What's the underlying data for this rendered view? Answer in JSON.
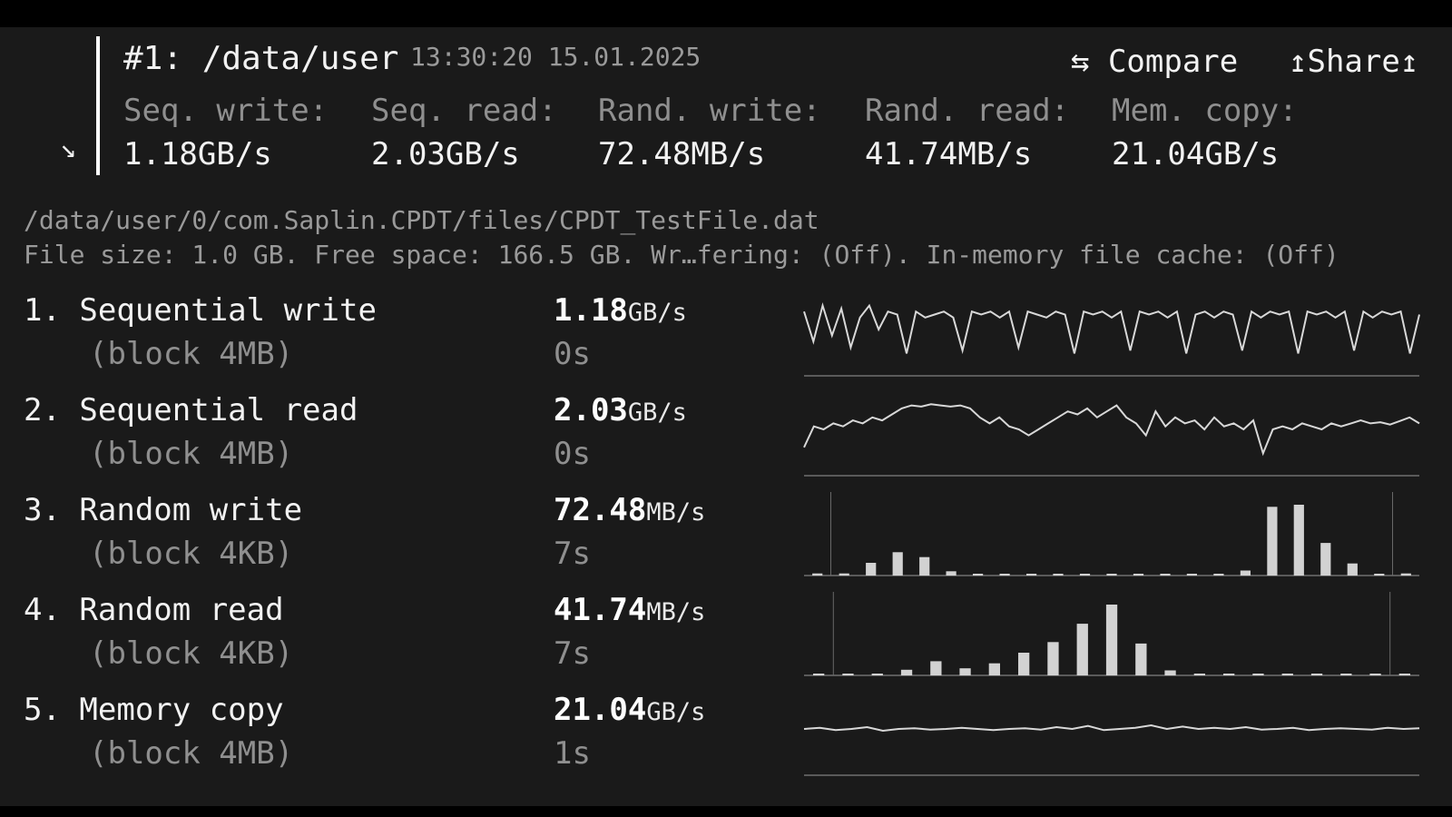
{
  "header": {
    "title": "#1: /data/user",
    "timestamp": "13:30:20 15.01.2025",
    "compare_label": "⇆ Compare",
    "share_label": "↥Share↥",
    "corner_arrow": "↘"
  },
  "summary": [
    {
      "label": "Seq. write:",
      "value": "1.18GB/s"
    },
    {
      "label": "Seq. read:",
      "value": "2.03GB/s"
    },
    {
      "label": "Rand. write:",
      "value": "72.48MB/s"
    },
    {
      "label": "Rand. read:",
      "value": "41.74MB/s"
    },
    {
      "label": "Mem. copy:",
      "value": "21.04GB/s"
    }
  ],
  "file_path": "/data/user/0/com.Saplin.CPDT/files/CPDT_TestFile.dat",
  "file_info": "File size: 1.0 GB. Free space: 166.5 GB. Wr…fering: (Off). In-memory file cache: (Off)",
  "tests": [
    {
      "name": "1. Sequential write",
      "block": "(block 4MB)",
      "value": "1.18",
      "unit": "GB/s",
      "time": "0s"
    },
    {
      "name": "2. Sequential read",
      "block": "(block 4MB)",
      "value": "2.03",
      "unit": "GB/s",
      "time": "0s"
    },
    {
      "name": "3. Random write",
      "block": "(block 4KB)",
      "value": "72.48",
      "unit": "MB/s",
      "time": "7s"
    },
    {
      "name": "4. Random read",
      "block": "(block 4KB)",
      "value": "41.74",
      "unit": "MB/s",
      "time": "7s"
    },
    {
      "name": "5. Memory copy",
      "block": "(block 4MB)",
      "value": "21.04",
      "unit": "GB/s",
      "time": "1s"
    }
  ],
  "chart_data": [
    {
      "type": "line",
      "series": [
        {
          "values": [
            0.8,
            0.3,
            0.9,
            0.4,
            0.85,
            0.2,
            0.7,
            0.9,
            0.5,
            0.8,
            0.75,
            0.1,
            0.8,
            0.7,
            0.75,
            0.8,
            0.7,
            0.15,
            0.8,
            0.75,
            0.8,
            0.7,
            0.8,
            0.2,
            0.8,
            0.75,
            0.7,
            0.8,
            0.75,
            0.1,
            0.8,
            0.75,
            0.8,
            0.7,
            0.8,
            0.15,
            0.8,
            0.75,
            0.8,
            0.7,
            0.8,
            0.1,
            0.75,
            0.8,
            0.7,
            0.8,
            0.75,
            0.15,
            0.8,
            0.7,
            0.8,
            0.75,
            0.8,
            0.1,
            0.8,
            0.75,
            0.8,
            0.7,
            0.8,
            0.15,
            0.8,
            0.7,
            0.8,
            0.75,
            0.8,
            0.1,
            0.75
          ]
        }
      ]
    },
    {
      "type": "line",
      "series": [
        {
          "values": [
            0.2,
            0.55,
            0.5,
            0.6,
            0.55,
            0.65,
            0.6,
            0.7,
            0.65,
            0.75,
            0.85,
            0.9,
            0.88,
            0.92,
            0.9,
            0.88,
            0.9,
            0.85,
            0.7,
            0.6,
            0.7,
            0.55,
            0.5,
            0.4,
            0.5,
            0.6,
            0.7,
            0.8,
            0.75,
            0.85,
            0.7,
            0.8,
            0.9,
            0.7,
            0.6,
            0.4,
            0.8,
            0.55,
            0.7,
            0.6,
            0.65,
            0.5,
            0.7,
            0.55,
            0.6,
            0.5,
            0.65,
            0.1,
            0.5,
            0.55,
            0.5,
            0.6,
            0.55,
            0.5,
            0.6,
            0.55,
            0.6,
            0.65,
            0.6,
            0.62,
            0.58,
            0.64,
            0.7,
            0.6
          ]
        }
      ]
    },
    {
      "type": "bar",
      "values": [
        0.03,
        0.03,
        0.18,
        0.33,
        0.26,
        0.06,
        0.01,
        0.01,
        0.01,
        0.01,
        0.01,
        0.01,
        0.01,
        0.01,
        0.02,
        0.02,
        0.07,
        0.97,
        1.0,
        0.46,
        0.17,
        0.02,
        0.03
      ]
    },
    {
      "type": "bar",
      "values": [
        0.01,
        0.01,
        0.01,
        0.08,
        0.2,
        0.1,
        0.17,
        0.32,
        0.47,
        0.73,
        1.0,
        0.45,
        0.07,
        0.01,
        0.01,
        0.01,
        0.01,
        0.01,
        0.01,
        0.01,
        0.01
      ]
    },
    {
      "type": "line",
      "series": [
        {
          "values": [
            0.5,
            0.52,
            0.48,
            0.5,
            0.53,
            0.47,
            0.5,
            0.51,
            0.49,
            0.5,
            0.52,
            0.5,
            0.48,
            0.5,
            0.51,
            0.49,
            0.53,
            0.5,
            0.55,
            0.48,
            0.5,
            0.52,
            0.56,
            0.5,
            0.54,
            0.5,
            0.52,
            0.5,
            0.53,
            0.49,
            0.5,
            0.52,
            0.48,
            0.5,
            0.51,
            0.5,
            0.49,
            0.52,
            0.5,
            0.51
          ]
        }
      ]
    }
  ]
}
